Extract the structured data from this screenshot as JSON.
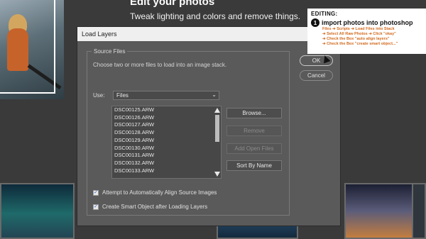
{
  "background": {
    "title": "Edit your photos",
    "subtitle": "Tweak lighting and colors and remove things."
  },
  "overlay": {
    "heading": "EDITING:",
    "step_number": "1",
    "step_title": "import photos into photoshop",
    "lines": [
      "Files ➔ Scripts ➔ Load Files into Stack",
      "➔ Select All Raw Photos ➔ Click \"okay\"",
      "➔ Check the Box \"auto align layers\"",
      "➔ Check the Box \"create smart object...\""
    ]
  },
  "dialog": {
    "title": "Load Layers",
    "close_label": "✕",
    "group_label": "Source Files",
    "description": "Choose two or more files to load into an image stack.",
    "use_label": "Use:",
    "use_value": "Files",
    "files": [
      "DSC00125.ARW",
      "DSC00126.ARW",
      "DSC00127.ARW",
      "DSC00128.ARW",
      "DSC00129.ARW",
      "DSC00130.ARW",
      "DSC00131.ARW",
      "DSC00132.ARW",
      "DSC00133.ARW"
    ],
    "browse_label": "Browse...",
    "remove_label": "Remove",
    "add_open_label": "Add Open Files",
    "sort_label": "Sort By Name",
    "align_label": "Attempt to Automatically Align Source Images",
    "align_checked": true,
    "smart_label": "Create Smart Object after Loading Layers",
    "smart_checked": true,
    "ok_label": "OK",
    "cancel_label": "Cancel"
  },
  "colors": {
    "dialog_bg": "#5a5a5a",
    "title_bar": "#efefef",
    "overlay_accent": "#d2691e"
  }
}
